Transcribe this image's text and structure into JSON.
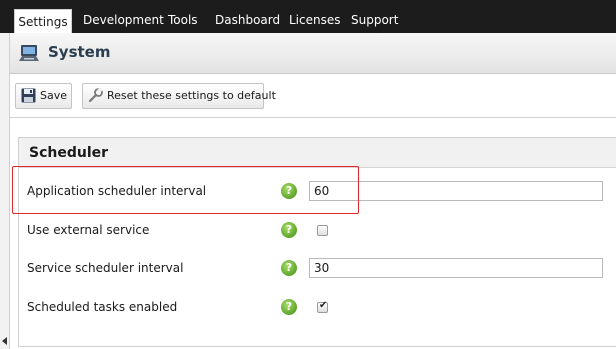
{
  "nav": {
    "tabs": [
      "Settings",
      "Development",
      "Tools",
      "Dashboard",
      "Licenses",
      "Support"
    ],
    "active_tab": "Settings"
  },
  "header": {
    "title": "System",
    "icon": "computer-icon"
  },
  "toolbar": {
    "save_label": "Save",
    "save_icon": "floppy-disk-icon",
    "reset_label": "Reset these settings to default",
    "reset_icon": "wrench-icon"
  },
  "scheduler": {
    "section_title": "Scheduler",
    "help_glyph": "?",
    "rows": [
      {
        "label": "Application scheduler interval",
        "type": "text",
        "value": "60"
      },
      {
        "label": "Use external service",
        "type": "checkbox",
        "checked": false
      },
      {
        "label": "Service scheduler interval",
        "type": "text",
        "value": "30"
      },
      {
        "label": "Scheduled tasks enabled",
        "type": "checkbox",
        "checked": true
      }
    ]
  },
  "colors": {
    "topbar_bg": "#1c1c1c",
    "highlight_border": "#e3262a",
    "help_green": "#5ea52a"
  }
}
